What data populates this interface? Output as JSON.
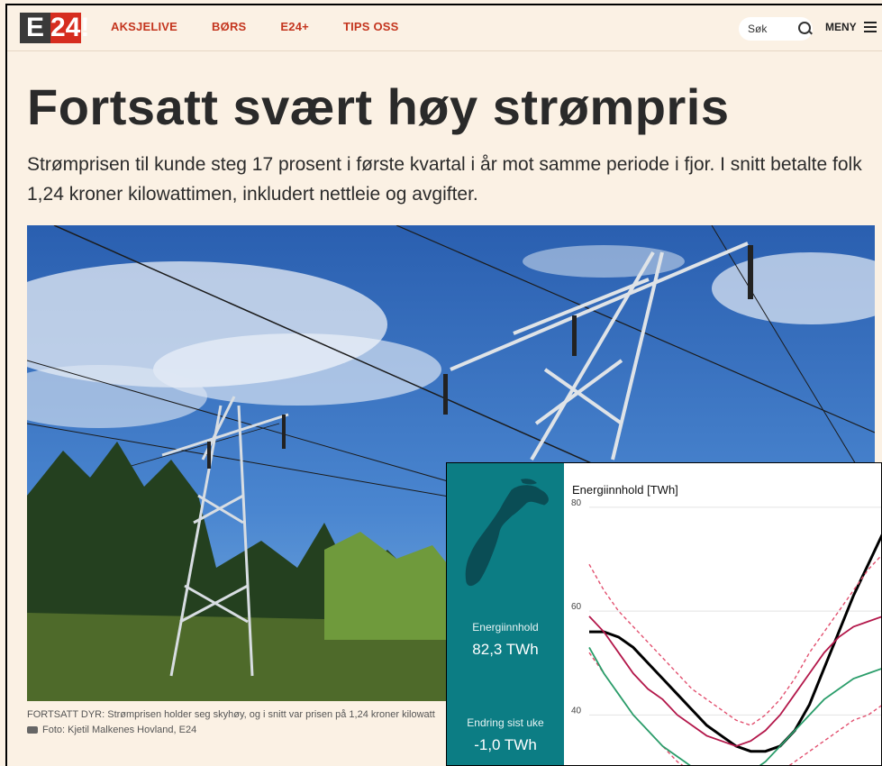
{
  "header": {
    "logo_left": "E",
    "logo_right": "24!",
    "nav": [
      "AKSJELIVE",
      "BØRS",
      "E24+",
      "TIPS OSS"
    ],
    "search_placeholder": "Søk",
    "menu_label": "MENY"
  },
  "article": {
    "title": "Fortsatt svært høy strømpris",
    "lead": "Strømprisen til kunde steg 17 prosent i første kvartal i år mot samme periode i fjor. I snitt betalte folk 1,24 kroner kilowattimen, inkludert nettleie og avgifter.",
    "caption": "FORTSATT DYR: Strømprisen holder seg skyhøy, og i snitt var prisen på 1,24 kroner kilowatt",
    "credit": "Foto: Kjetil Malkenes Hovland, E24"
  },
  "inset": {
    "stat1_label": "Energiinnhold",
    "stat1_value": "82,3 TWh",
    "stat2_label": "Endring sist uke",
    "stat2_value": "-1,0 TWh"
  },
  "colors": {
    "accent": "#c4361f",
    "teal": "#0c7d84",
    "black_line": "#000000",
    "red_line": "#b3174a",
    "dashed_line": "#e2506f",
    "green_line": "#2a9d6a"
  },
  "chart_data": {
    "type": "line",
    "title": "Energiinnhold [TWh]",
    "yticks": [
      40,
      60,
      80
    ],
    "ylim": [
      30,
      85
    ],
    "xlim": [
      0,
      100
    ],
    "series": [
      {
        "style": "black",
        "x": [
          0,
          5,
          10,
          15,
          20,
          25,
          30,
          35,
          40,
          45,
          50,
          55,
          60,
          65,
          70,
          75,
          80,
          85,
          90,
          95,
          100
        ],
        "values": [
          56,
          56,
          55,
          53,
          50,
          47,
          44,
          41,
          38,
          36,
          34,
          33,
          33,
          34,
          37,
          42,
          49,
          56,
          63,
          69,
          75
        ]
      },
      {
        "style": "red",
        "x": [
          0,
          5,
          10,
          15,
          20,
          25,
          30,
          35,
          40,
          45,
          50,
          55,
          60,
          65,
          70,
          75,
          80,
          85,
          90,
          95,
          100
        ],
        "values": [
          59,
          56,
          52,
          48,
          45,
          43,
          40,
          38,
          36,
          35,
          34,
          35,
          37,
          40,
          44,
          48,
          52,
          55,
          57,
          58,
          59
        ]
      },
      {
        "style": "dashed",
        "x": [
          0,
          5,
          10,
          15,
          20,
          25,
          30,
          35,
          40,
          45,
          50,
          55,
          60,
          65,
          70,
          75,
          80,
          85,
          90,
          95,
          100
        ],
        "values": [
          69,
          64,
          60,
          57,
          54,
          51,
          48,
          45,
          43,
          41,
          39,
          38,
          40,
          43,
          47,
          52,
          56,
          60,
          64,
          68,
          71
        ]
      },
      {
        "style": "dashed",
        "x": [
          0,
          5,
          10,
          15,
          20,
          25,
          30,
          35,
          40,
          45,
          50,
          55,
          60,
          65,
          70,
          75,
          80,
          85,
          90,
          95,
          100
        ],
        "values": [
          52,
          48,
          44,
          40,
          37,
          34,
          31,
          29,
          28,
          27,
          26,
          26,
          27,
          29,
          31,
          33,
          35,
          37,
          39,
          40,
          42
        ]
      },
      {
        "style": "green",
        "x": [
          0,
          5,
          10,
          15,
          20,
          25,
          30,
          35,
          40,
          45,
          50,
          55,
          60,
          65,
          70,
          75,
          80,
          85,
          90,
          95,
          100
        ],
        "values": [
          53,
          48,
          44,
          40,
          37,
          34,
          32,
          30,
          29,
          28,
          28,
          29,
          31,
          34,
          37,
          40,
          43,
          45,
          47,
          48,
          49
        ]
      }
    ]
  }
}
